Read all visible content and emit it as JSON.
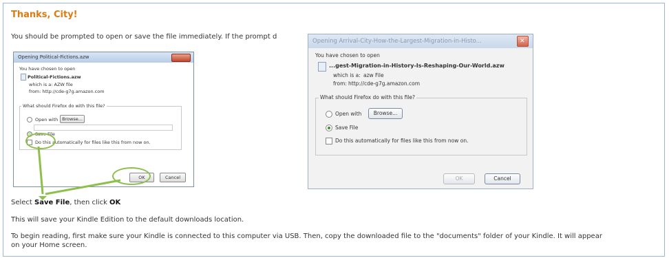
{
  "page": {
    "title": "Thanks, City!",
    "intro": "You should be prompted to open or save the file immediately. If the prompt d",
    "instruction_prefix": "Select ",
    "instruction_save": "Save File",
    "instruction_mid": ", then click ",
    "instruction_ok": "OK",
    "paragraph1": "This will save your Kindle Edition to the default downloads location.",
    "paragraph2_line1": "To begin reading, first make sure your Kindle is connected to this computer via USB. Then, copy the downloaded file to the \"documents\" folder of your Kindle. It will appear",
    "paragraph2_line2": "on your Home screen."
  },
  "small_dialog": {
    "title": "Opening Political-Fictions.azw",
    "chosen": "You have chosen to open",
    "filename": "Political-Fictions.azw",
    "which_is": "which is a: AZW file",
    "from": "from: http://cde-g7g.amazon.com",
    "question": "What should Firefox do with this file?",
    "open_with": "Open with",
    "browse": "Browse...",
    "save_file": "Save File",
    "auto": "Do this automatically for files like this from now on.",
    "ok": "OK",
    "cancel": "Cancel"
  },
  "big_dialog": {
    "title": "Opening Arrival-City-How-the-Largest-Migration-in-Histo...",
    "chosen": "You have chosen to open",
    "filename": "...gest-Migration-in-History-Is-Reshaping-Our-World.azw",
    "which_is_label": "which is a:",
    "which_is_value": "azw File",
    "from_label": "from:",
    "from_value": "http://cde-g7g.amazon.com",
    "question": "What should Firefox do with this file?",
    "open_with": "Open with",
    "browse": "Browse...",
    "save_file": "Save File",
    "auto": "Do this automatically for files like this from now on.",
    "ok": "OK",
    "cancel": "Cancel"
  },
  "colors": {
    "title": "#e07a10",
    "highlight": "#8cc04b",
    "frame_border": "#9bb7d6"
  }
}
